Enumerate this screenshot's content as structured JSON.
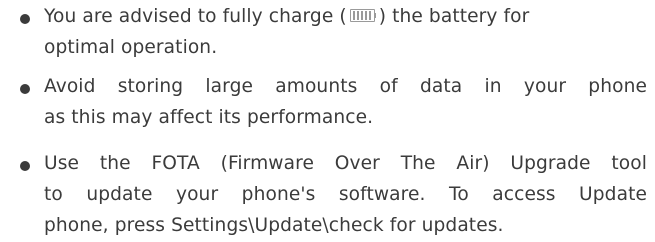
{
  "tips": [
    {
      "line1_before_icon": "You are advised to fully charge (",
      "line1_after_icon": ") the battery for",
      "line2": "optimal operation.",
      "icon": "battery-full-icon"
    },
    {
      "line1": "Avoid storing large amounts of data in your phone",
      "line2": "as this may affect its performance."
    },
    {
      "line1": "Use the FOTA (Firmware Over The Air) Upgrade tool",
      "line2": "to update your phone's software. To access Update",
      "line3": "phone, press Settings\\Update\\check for updates."
    }
  ]
}
